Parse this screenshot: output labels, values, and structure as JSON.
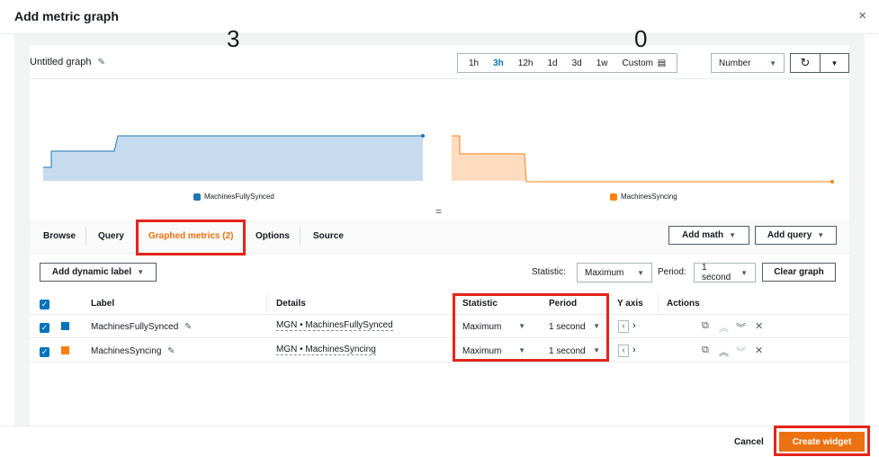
{
  "modal": {
    "title": "Add metric graph",
    "close_icon": "×"
  },
  "graph": {
    "title": "Untitled graph",
    "edit_icon": "✎",
    "time_ranges": [
      "1h",
      "3h",
      "12h",
      "1d",
      "3d",
      "1w"
    ],
    "active_time_range": "3h",
    "custom_label": "Custom",
    "calendar_icon": "▤",
    "view_type": "Number",
    "refresh_icon": "↻",
    "caret": "▼",
    "drag_handle": "="
  },
  "widgets": [
    {
      "value": "3",
      "legend": "MachinesFullySynced",
      "color": "#1f77b4"
    },
    {
      "value": "0",
      "legend": "MachinesSyncing",
      "color": "#ff7f0e"
    }
  ],
  "chart_data": [
    {
      "type": "area",
      "series": [
        {
          "name": "MachinesFullySynced",
          "color": "#1f77b4"
        }
      ],
      "value_label": "3"
    },
    {
      "type": "area",
      "series": [
        {
          "name": "MachinesSyncing",
          "color": "#ff7f0e"
        }
      ],
      "value_label": "0"
    }
  ],
  "tabs": [
    {
      "label": "Browse",
      "active": false
    },
    {
      "label": "Query",
      "active": false
    },
    {
      "label": "Graphed metrics (2)",
      "active": true
    },
    {
      "label": "Options",
      "active": false
    },
    {
      "label": "Source",
      "active": false
    }
  ],
  "tab_buttons": {
    "add_math": "Add math",
    "add_query": "Add query"
  },
  "toolbar": {
    "add_dynamic_label": "Add dynamic label",
    "statistic_label": "Statistic:",
    "statistic_value": "Maximum",
    "period_label": "Period:",
    "period_value": "1 second",
    "clear_graph": "Clear graph"
  },
  "table": {
    "headers": {
      "label": "Label",
      "details": "Details",
      "statistic": "Statistic",
      "period": "Period",
      "y_axis": "Y axis",
      "actions": "Actions"
    },
    "rows": [
      {
        "label": "MachinesFullySynced",
        "details": "MGN • MachinesFullySynced",
        "statistic": "Maximum",
        "period": "1 second",
        "color": "#0073bb"
      },
      {
        "label": "MachinesSyncing",
        "details": "MGN • MachinesSyncing",
        "statistic": "Maximum",
        "period": "1 second",
        "color": "#ff7f0e"
      }
    ]
  },
  "footer": {
    "cancel": "Cancel",
    "create": "Create widget"
  }
}
